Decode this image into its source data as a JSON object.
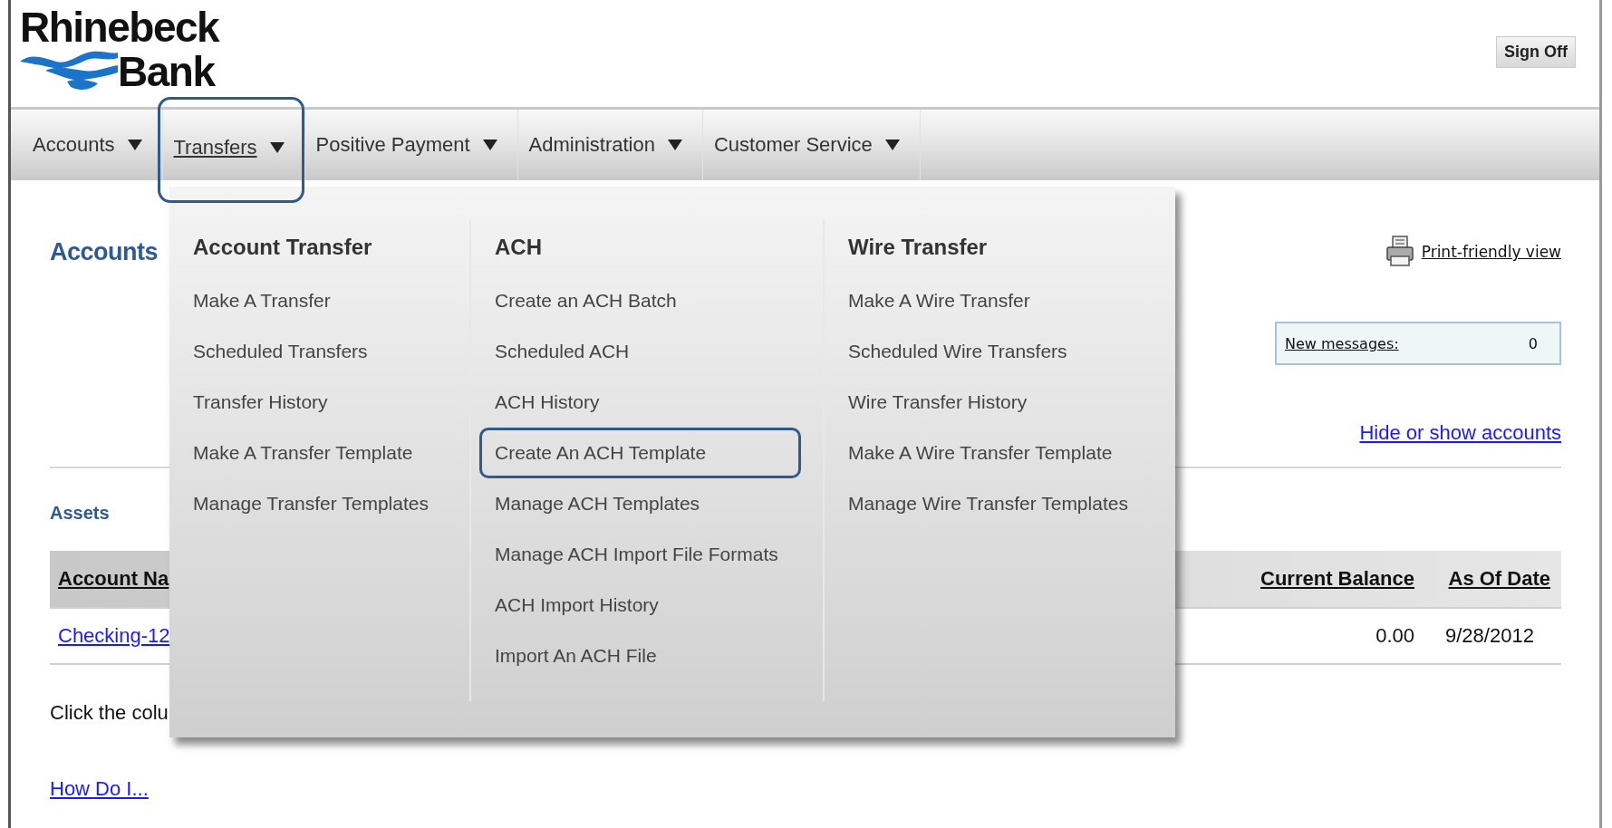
{
  "logo": {
    "line_1": "Rhinebeck",
    "line_2": "Bank"
  },
  "sign_off": "Sign Off",
  "nav": [
    {
      "label": "Accounts",
      "selected": false,
      "highlighted": false
    },
    {
      "label": "Transfers",
      "selected": true,
      "highlighted": true
    },
    {
      "label": "Positive Payment",
      "selected": false,
      "highlighted": false
    },
    {
      "label": "Administration",
      "selected": false,
      "highlighted": false
    },
    {
      "label": "Customer Service",
      "selected": false,
      "highlighted": false
    }
  ],
  "menu": {
    "columns": [
      {
        "heading": "Account Transfer",
        "items": [
          {
            "label": "Make A Transfer",
            "highlighted": false
          },
          {
            "label": "Scheduled Transfers",
            "highlighted": false
          },
          {
            "label": "Transfer History",
            "highlighted": false
          },
          {
            "label": "Make A Transfer Template",
            "highlighted": false
          },
          {
            "label": "Manage Transfer Templates",
            "highlighted": false
          }
        ]
      },
      {
        "heading": "ACH",
        "items": [
          {
            "label": "Create an ACH Batch",
            "highlighted": false
          },
          {
            "label": "Scheduled ACH",
            "highlighted": false
          },
          {
            "label": "ACH History",
            "highlighted": false
          },
          {
            "label": "Create An ACH Template",
            "highlighted": true
          },
          {
            "label": "Manage ACH Templates",
            "highlighted": false
          },
          {
            "label": "Manage ACH Import File Formats",
            "highlighted": false
          },
          {
            "label": "ACH Import History",
            "highlighted": false
          },
          {
            "label": "Import An ACH File",
            "highlighted": false
          }
        ]
      },
      {
        "heading": "Wire Transfer",
        "items": [
          {
            "label": "Make A Wire Transfer",
            "highlighted": false
          },
          {
            "label": "Scheduled Wire Transfers",
            "highlighted": false
          },
          {
            "label": "Wire Transfer History",
            "highlighted": false
          },
          {
            "label": "Make A Wire Transfer Template",
            "highlighted": false
          },
          {
            "label": "Manage Wire Transfer Templates",
            "highlighted": false
          }
        ]
      }
    ]
  },
  "page": {
    "title": "Accounts",
    "print_link": "Print-friendly view",
    "messages": {
      "label": "New messages:",
      "count": "0"
    },
    "hide_show_link": "Hide or show accounts",
    "section": "Assets",
    "table": {
      "columns": [
        "Account Na",
        "Current Balance",
        "As Of Date"
      ],
      "rows": [
        [
          "Checking-12",
          "0.00",
          "9/28/2012"
        ]
      ]
    },
    "hint": "Click the colu",
    "help_link": "How Do I..."
  }
}
